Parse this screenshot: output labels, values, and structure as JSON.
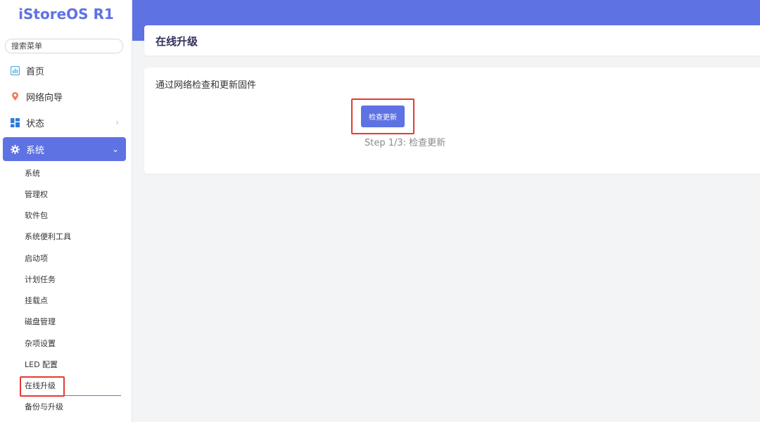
{
  "brand": {
    "title": "iStoreOS R1"
  },
  "search": {
    "placeholder": "搜索菜单"
  },
  "menu": {
    "home": "首页",
    "wizard": "网络向导",
    "status": "状态",
    "system": "系统"
  },
  "submenu": [
    "系统",
    "管理权",
    "软件包",
    "系统便利工具",
    "启动项",
    "计划任务",
    "挂载点",
    "磁盘管理",
    "杂项设置",
    "LED 配置",
    "在线升级",
    "备份与升级"
  ],
  "page": {
    "title": "在线升级",
    "description": "通过网络检查和更新固件",
    "check_button": "检查更新",
    "step_text": "Step 1/3: 检查更新"
  },
  "colors": {
    "accent": "#5e72e4",
    "highlight_box": "#e53935"
  }
}
